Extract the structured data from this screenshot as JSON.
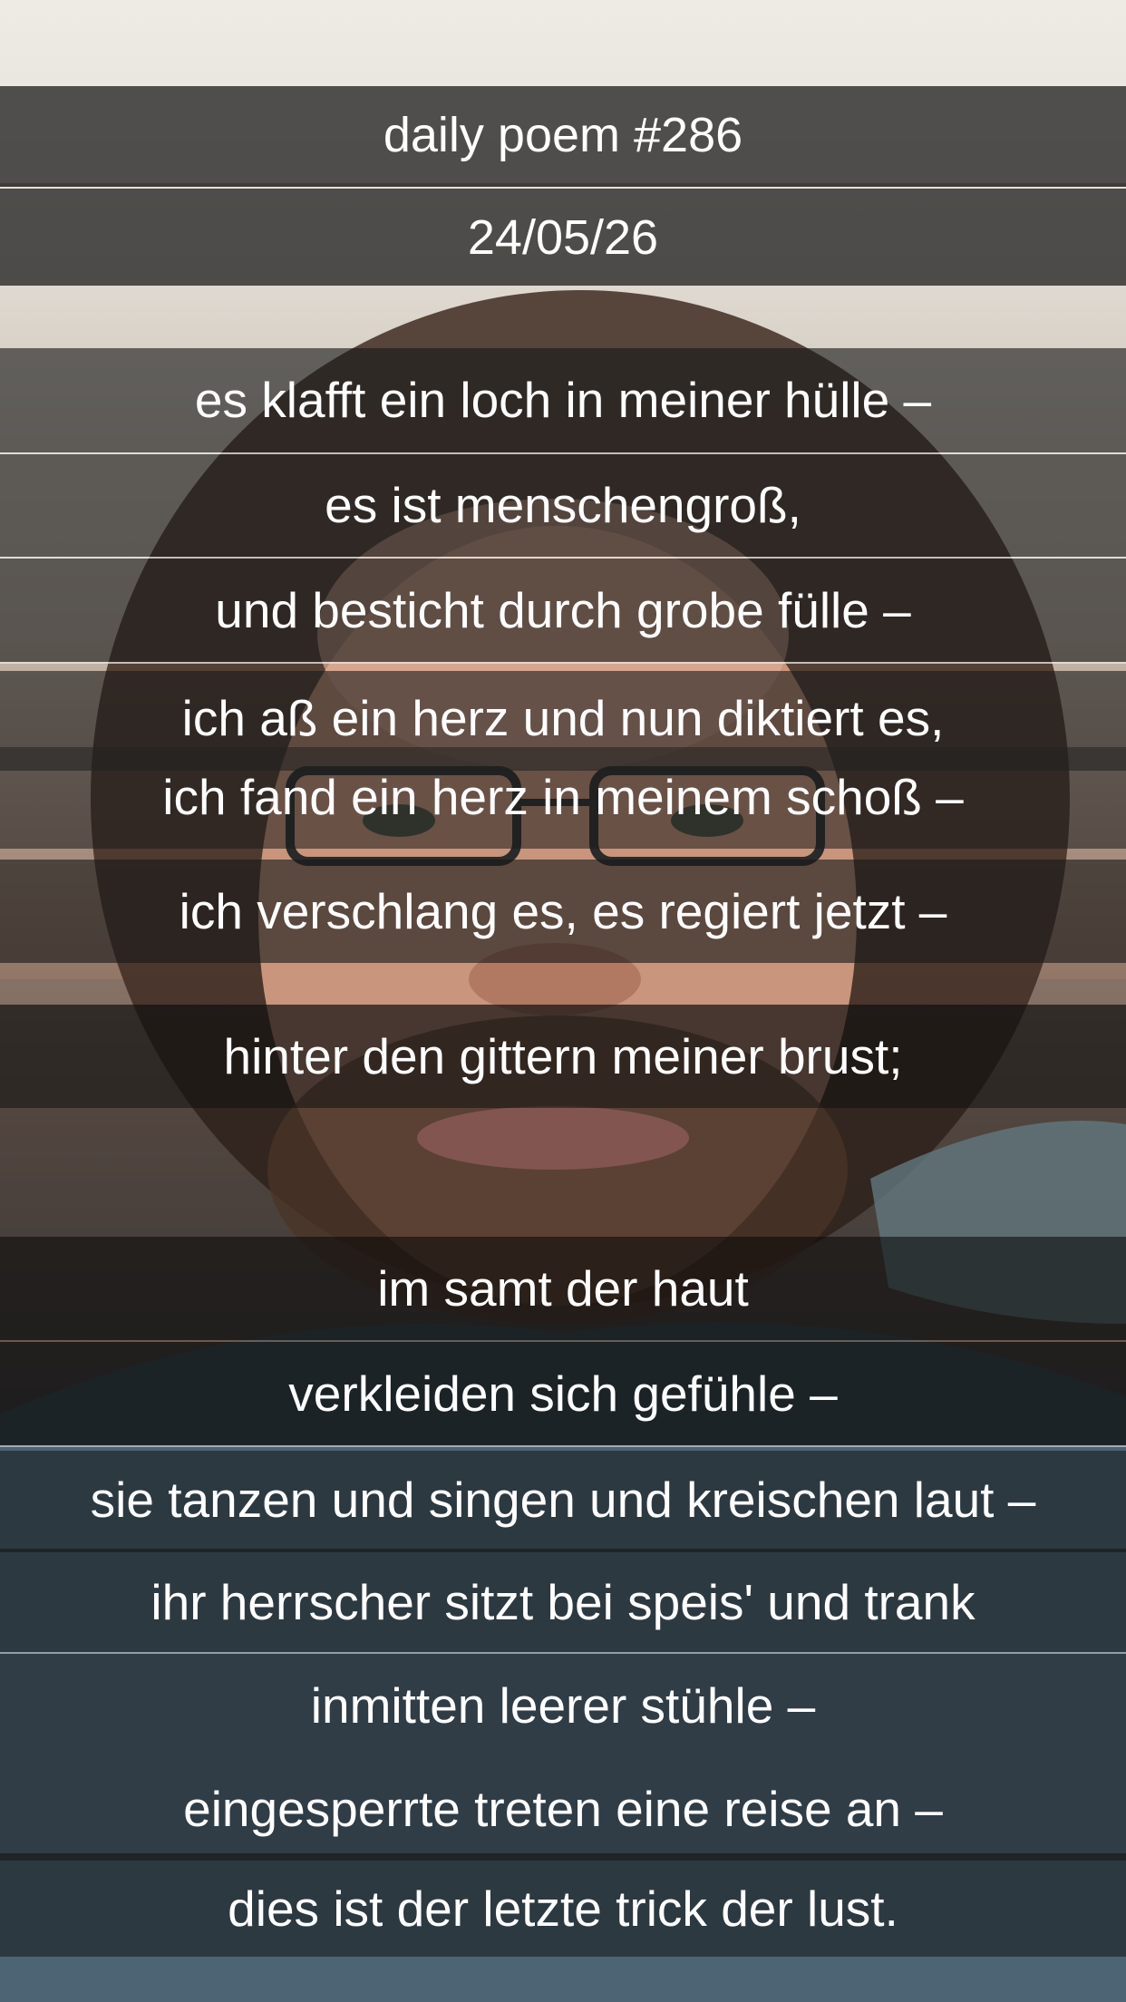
{
  "header": {
    "title": "daily poem #286",
    "date": "24/05/26"
  },
  "poem": {
    "lines": [
      "es klafft ein loch in meiner hülle –",
      "es ist menschengroß,",
      "und besticht durch grobe fülle –",
      "ich aß ein herz und nun diktiert es,",
      "ich fand ein herz in meinem schoß –",
      "ich verschlang es, es regiert jetzt –",
      "hinter den gittern meiner brust;",
      "im samt der haut",
      "verkleiden sich gefühle –",
      "sie tanzen und singen und kreischen laut –",
      "ihr herrscher sitzt bei speis' und trank",
      "inmitten leerer stühle –",
      "eingesperrte treten eine reise an –",
      "dies ist der letzte trick der lust."
    ]
  },
  "background": {
    "subject": "selfie-photo",
    "text_color": "#ffffff",
    "overlay_color": "#000000"
  }
}
